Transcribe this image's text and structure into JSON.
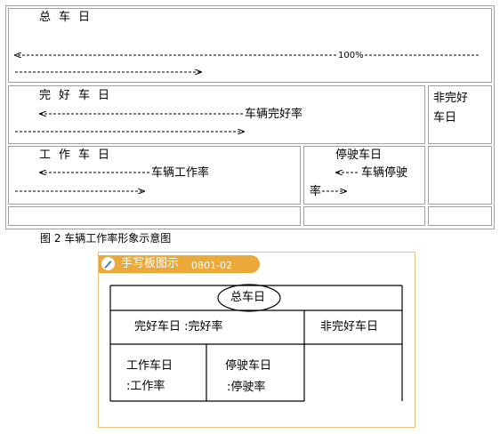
{
  "figure_caption": "图 2 车辆工作率形象示意图",
  "rows": {
    "total": {
      "label": "总车日",
      "percent": "100%"
    },
    "good": {
      "label": "完好车日",
      "rate": "车辆完好率",
      "side": "非完好车日"
    },
    "work": {
      "label": "工作车日",
      "rate": "车辆工作率",
      "idle_label": "停驶车日",
      "idle_rate_1": "车辆停驶",
      "idle_rate_2": "率"
    }
  },
  "sketch": {
    "tag_title": "手写板图示",
    "tag_code": "0801-02",
    "total": "总车日",
    "good": "完好车日 :完好率",
    "bad": "非完好车日",
    "work_1": "工作车日",
    "work_2": ":工作率",
    "idle_1": "停驶车日",
    "idle_2": ":停驶率"
  },
  "colors": {
    "tag_bg": "#eba93a",
    "sketch_border": "#e8c27a",
    "table_border": "#a0a0a0"
  }
}
